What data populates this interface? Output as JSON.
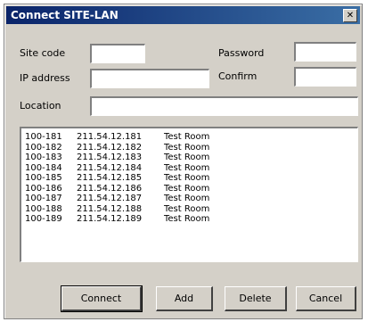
{
  "window": {
    "title": "Connect SITE-LAN",
    "close_glyph": "✕"
  },
  "form": {
    "site_code_label": "Site code",
    "ip_address_label": "IP address",
    "location_label": "Location",
    "password_label": "Password",
    "confirm_label": "Confirm",
    "site_code_value": "",
    "ip_address_value": "",
    "location_value": "",
    "password_value": "",
    "confirm_value": ""
  },
  "list": {
    "rows": [
      [
        "100-181",
        "211.54.12.181",
        "Test Room"
      ],
      [
        "100-182",
        "211.54.12.182",
        "Test Room"
      ],
      [
        "100-183",
        "211.54.12.183",
        "Test Room"
      ],
      [
        "100-184",
        "211.54.12.184",
        "Test Room"
      ],
      [
        "100-185",
        "211.54.12.185",
        "Test Room"
      ],
      [
        "100-186",
        "211.54.12.186",
        "Test Room"
      ],
      [
        "100-187",
        "211.54.12.187",
        "Test Room"
      ],
      [
        "100-188",
        "211.54.12.188",
        "Test Room"
      ],
      [
        "100-189",
        "211.54.12.189",
        "Test Room"
      ]
    ]
  },
  "buttons": {
    "connect": "Connect",
    "add": "Add",
    "delete": "Delete",
    "cancel": "Cancel"
  }
}
